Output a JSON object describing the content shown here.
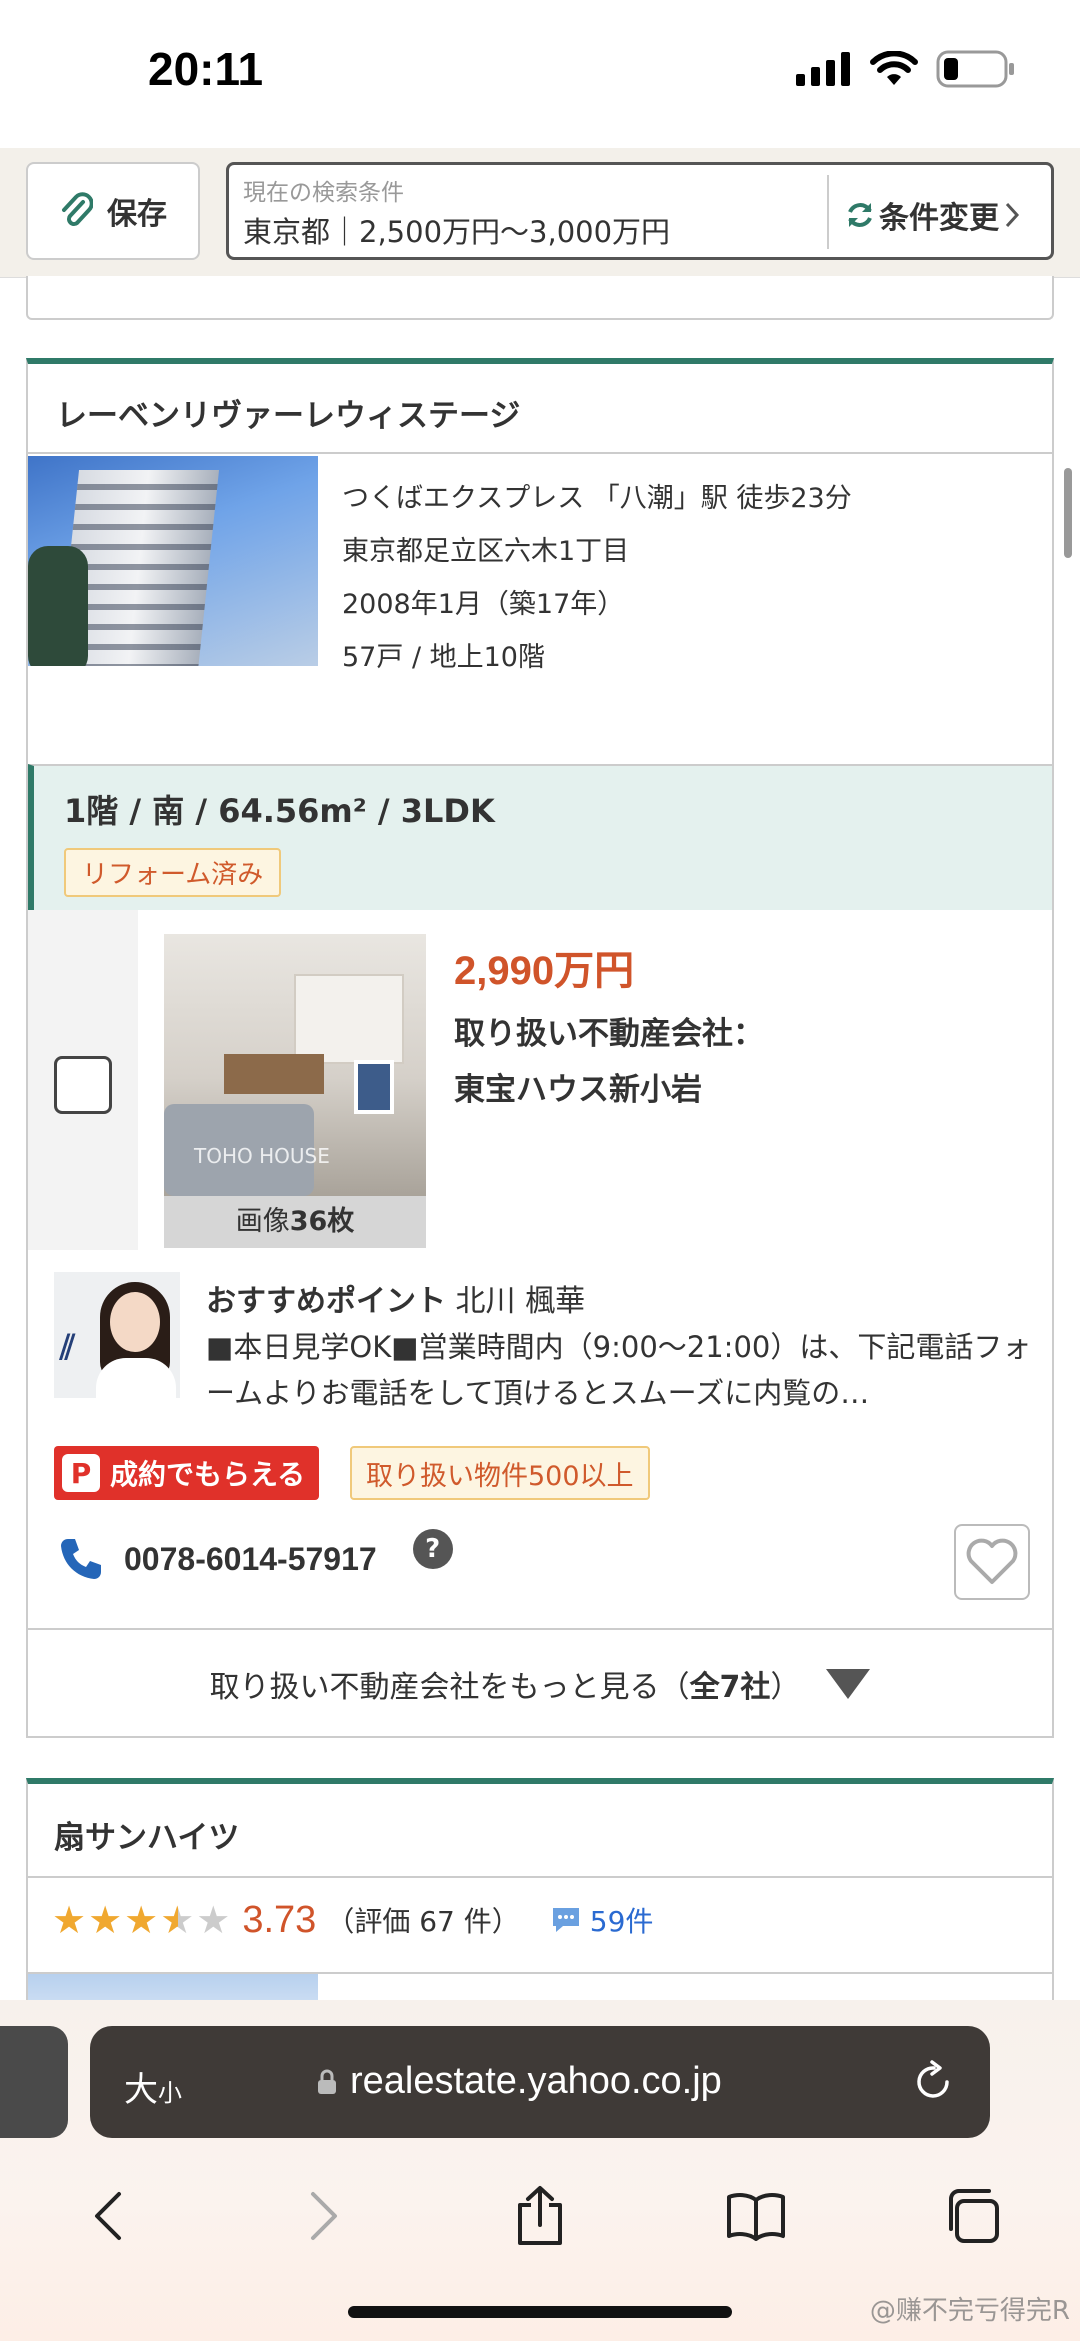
{
  "status_bar": {
    "time": "20:11"
  },
  "search_header": {
    "save_label": "保存",
    "condition_label": "現在の検索条件",
    "condition_value": "東京都｜2,500万円〜3,000万円",
    "change_label": "条件変更"
  },
  "property": {
    "name": "レーベンリヴァーレウィステージ",
    "photo_logo": "TOHO HOUSE",
    "access": "つくばエクスプレス 「八潮」駅 徒歩23分",
    "address": "東京都足立区六木1丁目",
    "built": "2008年1月（築17年）",
    "units_floors": "57戸 / 地上10階",
    "unit_title": "1階 / 南 / 64.56m² / 3LDK",
    "unit_badge": "リフォーム済み",
    "listing": {
      "photo_count_prefix": "画像",
      "photo_count": "36",
      "photo_count_suffix": "枚",
      "price": "2,990万円",
      "agency_label": "取り扱い不動産会社：",
      "agency_name": "東宝ハウス新小岩"
    },
    "recommend": {
      "title": "おすすめポイント",
      "agent": "北川 楓華",
      "text": "■本日見学OK■営業時間内（9:00〜21:00）は、下記電話フォームよりお電話をして頂けるとスムーズに内覧の…"
    },
    "badges": {
      "red": "成約でもらえる",
      "red_icon": "P",
      "outline": "取り扱い物件500以上"
    },
    "phone": "0078-6014-57917",
    "help_icon": "?",
    "more_label": "取り扱い不動産会社をもっと見る（",
    "more_count": "全7社",
    "more_close": "）"
  },
  "next_property": {
    "name": "扇サンハイツ",
    "rating": "3.73",
    "rating_count": "（評価 67 件）",
    "reviews": "59件",
    "stars": 3.5
  },
  "browser": {
    "text_size": "大",
    "text_size_small": "小",
    "url": "realestate.yahoo.co.jp"
  },
  "watermark": "@赚不完亏得完R",
  "colors": {
    "accent": "#2f7a68",
    "price": "#d0542a",
    "link": "#2a6ad1",
    "badge_red": "#e0312a"
  }
}
